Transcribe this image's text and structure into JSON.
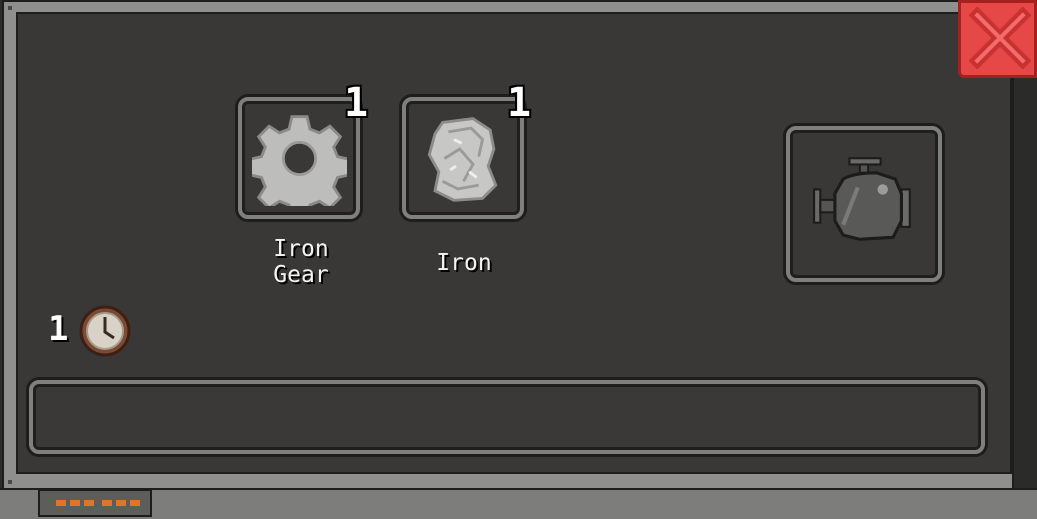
{
  "recipe": {
    "ingredients": [
      {
        "name": "Iron\nGear",
        "quantity": "1",
        "icon": "gear-icon"
      },
      {
        "name": "Iron",
        "quantity": "1",
        "icon": "iron-ore-icon"
      }
    ],
    "output": {
      "icon": "engine-icon"
    },
    "time": {
      "value": "1",
      "icon": "clock-icon"
    },
    "progress": 0
  },
  "colors": {
    "panel_bg": "#393836",
    "frame": "#8f908e",
    "close_red": "#e64847",
    "accent_orange": "#e0752a"
  }
}
